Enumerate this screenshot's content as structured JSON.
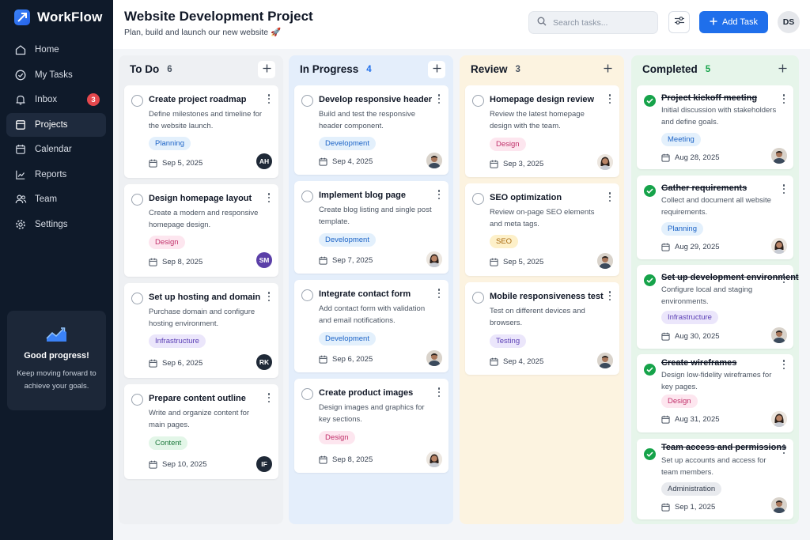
{
  "sidebar": {
    "brand": "WorkFlow",
    "items": [
      {
        "label": "Home",
        "icon": "home-icon"
      },
      {
        "label": "My Tasks",
        "icon": "check-circle-icon"
      },
      {
        "label": "Inbox",
        "icon": "bell-icon",
        "badge": "3"
      },
      {
        "label": "Projects",
        "icon": "folder-icon",
        "active": true
      },
      {
        "label": "Calendar",
        "icon": "calendar-icon"
      },
      {
        "label": "Reports",
        "icon": "chart-icon"
      },
      {
        "label": "Team",
        "icon": "team-icon"
      },
      {
        "label": "Settings",
        "icon": "gear-icon"
      }
    ],
    "promo": {
      "title": "Good progress!",
      "text": "Keep moving forward to achieve your goals."
    }
  },
  "header": {
    "title": "Website Development Project",
    "subtitle": "Plan, build and launch our new website 🚀",
    "search_placeholder": "Search tasks...",
    "add_task_label": "Add Task",
    "user_initials": "DS"
  },
  "colors": {
    "accent": "#1f6feb",
    "sidebar_bg": "#0f1a2a",
    "done": "#16a34a"
  },
  "columns": {
    "todo": {
      "title": "To Do",
      "count": "6",
      "cards": [
        {
          "title": "Create project roadmap",
          "desc": "Define milestones and timeline for the website launch.",
          "tag": "Planning",
          "date": "Sep 5, 2025",
          "assignee": "AH"
        },
        {
          "title": "Design homepage layout",
          "desc": "Create a modern and responsive homepage design.",
          "tag": "Design",
          "date": "Sep 8, 2025",
          "assignee": "SM"
        },
        {
          "title": "Set up hosting and domain",
          "desc": "Purchase domain and configure hosting environment.",
          "tag": "Infrastructure",
          "date": "Sep 6, 2025",
          "assignee": "RK"
        },
        {
          "title": "Prepare content outline",
          "desc": "Write and organize content for main pages.",
          "tag": "Content",
          "date": "Sep 10, 2025",
          "assignee": "IF"
        }
      ]
    },
    "progress": {
      "title": "In Progress",
      "count": "4",
      "cards": [
        {
          "title": "Develop responsive header",
          "desc": "Build and test the responsive header component.",
          "tag": "Development",
          "date": "Sep 4, 2025"
        },
        {
          "title": "Implement blog page",
          "desc": "Create blog listing and single post template.",
          "tag": "Development",
          "date": "Sep 7, 2025"
        },
        {
          "title": "Integrate contact form",
          "desc": "Add contact form with validation and email notifications.",
          "tag": "Development",
          "date": "Sep 6, 2025"
        },
        {
          "title": "Create product images",
          "desc": "Design images and graphics for key sections.",
          "tag": "Design",
          "date": "Sep 8, 2025"
        }
      ]
    },
    "review": {
      "title": "Review",
      "count": "3",
      "cards": [
        {
          "title": "Homepage design review",
          "desc": "Review the latest homepage design with the team.",
          "tag": "Design",
          "date": "Sep 3, 2025"
        },
        {
          "title": "SEO optimization",
          "desc": "Review on-page SEO elements and meta tags.",
          "tag": "SEO",
          "date": "Sep 5, 2025"
        },
        {
          "title": "Mobile responsiveness test",
          "desc": "Test on different devices and browsers.",
          "tag": "Testing",
          "date": "Sep 4, 2025"
        }
      ]
    },
    "done": {
      "title": "Completed",
      "count": "5",
      "cards": [
        {
          "title": "Project kickoff meeting",
          "desc": "Initial discussion with stakeholders and define goals.",
          "tag": "Meeting",
          "date": "Aug 28, 2025"
        },
        {
          "title": "Gather requirements",
          "desc": "Collect and document all website requirements.",
          "tag": "Planning",
          "date": "Aug 29, 2025"
        },
        {
          "title": "Set up development environment",
          "desc": "Configure local and staging environments.",
          "tag": "Infrastructure",
          "date": "Aug 30, 2025"
        },
        {
          "title": "Create wireframes",
          "desc": "Design low-fidelity wireframes for key pages.",
          "tag": "Design",
          "date": "Aug 31, 2025"
        },
        {
          "title": "Team access and permissions",
          "desc": "Set up accounts and access for team members.",
          "tag": "Administration",
          "date": "Sep 1, 2025"
        }
      ]
    }
  }
}
